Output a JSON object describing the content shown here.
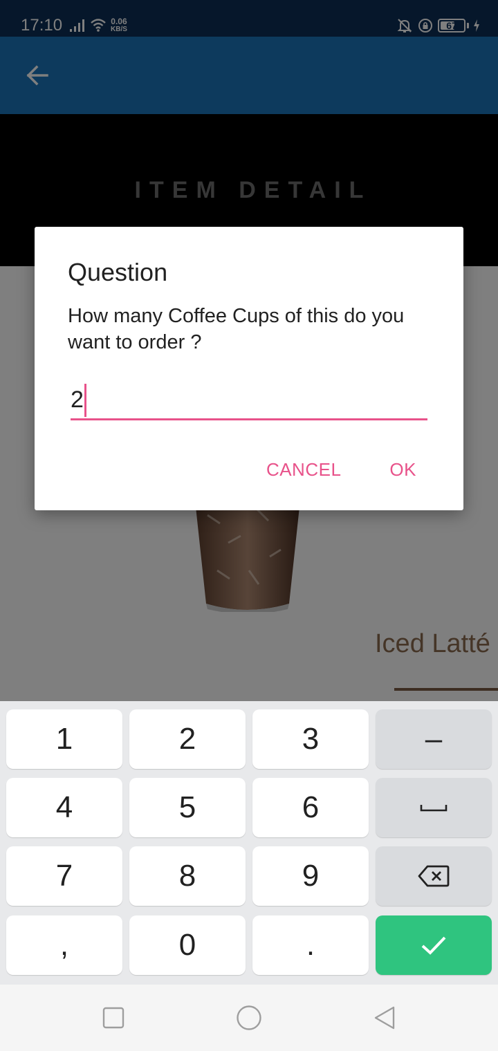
{
  "status_bar": {
    "time": "17:10",
    "net_speed_value": "0.06",
    "net_speed_unit": "KB/S",
    "battery_level": "67",
    "battery_fraction": 0.67,
    "icons": [
      "signal-icon",
      "wifi-icon",
      "mute-bell-icon",
      "rotation-lock-icon",
      "battery-icon",
      "charging-icon"
    ]
  },
  "app_bar": {
    "back_icon": "arrow-left-icon"
  },
  "content": {
    "banner_title": "ITEM DETAIL",
    "item_name": "Iced Latté",
    "item_image": "iced-coffee-glass"
  },
  "dialog": {
    "title": "Question",
    "message": "How many Coffee Cups of this  do you want to order ?",
    "input_value": "2",
    "cancel_label": "CANCEL",
    "ok_label": "OK",
    "accent_color": "#e8528a"
  },
  "keyboard": {
    "rows": [
      [
        {
          "label": "1"
        },
        {
          "label": "2"
        },
        {
          "label": "3"
        },
        {
          "label": "–",
          "type": "func"
        }
      ],
      [
        {
          "label": "4"
        },
        {
          "label": "5"
        },
        {
          "label": "6"
        },
        {
          "label": "",
          "type": "func",
          "icon": "space-icon"
        }
      ],
      [
        {
          "label": "7"
        },
        {
          "label": "8"
        },
        {
          "label": "9"
        },
        {
          "label": "",
          "type": "func",
          "icon": "backspace-icon"
        }
      ],
      [
        {
          "label": ","
        },
        {
          "label": "0"
        },
        {
          "label": "."
        },
        {
          "label": "",
          "type": "done",
          "icon": "check-icon"
        }
      ]
    ],
    "done_color": "#2fc47f"
  },
  "nav_bar": {
    "icons": [
      "recents-square-icon",
      "home-circle-icon",
      "back-triangle-icon"
    ]
  },
  "colors": {
    "status_bar": "#0d2f57",
    "app_bar": "#1b75bb",
    "accent": "#e8528a"
  }
}
